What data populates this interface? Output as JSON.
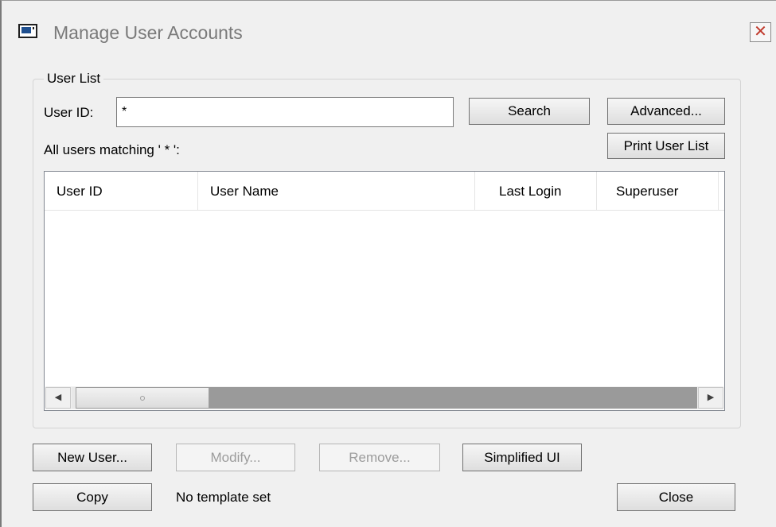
{
  "window": {
    "title": "Manage User Accounts",
    "close_glyph": "✕",
    "icon": "window-icon"
  },
  "user_list": {
    "group_label": "User List",
    "user_id_label": "User ID:",
    "user_id_value": "*",
    "search_label": "Search",
    "advanced_label": "Advanced...",
    "print_label": "Print User List",
    "matching_text": "All users matching ' * ':",
    "columns": [
      "User ID",
      "User Name",
      "Last Login",
      "Superuser"
    ],
    "rows": []
  },
  "scrollbar": {
    "left_arrow": "◀",
    "right_arrow": "▶"
  },
  "actions": {
    "new_user_label": "New User...",
    "modify_label": "Modify...",
    "remove_label": "Remove...",
    "simplified_label": "Simplified UI",
    "copy_label": "Copy",
    "template_status": "No template set",
    "close_label": "Close"
  }
}
